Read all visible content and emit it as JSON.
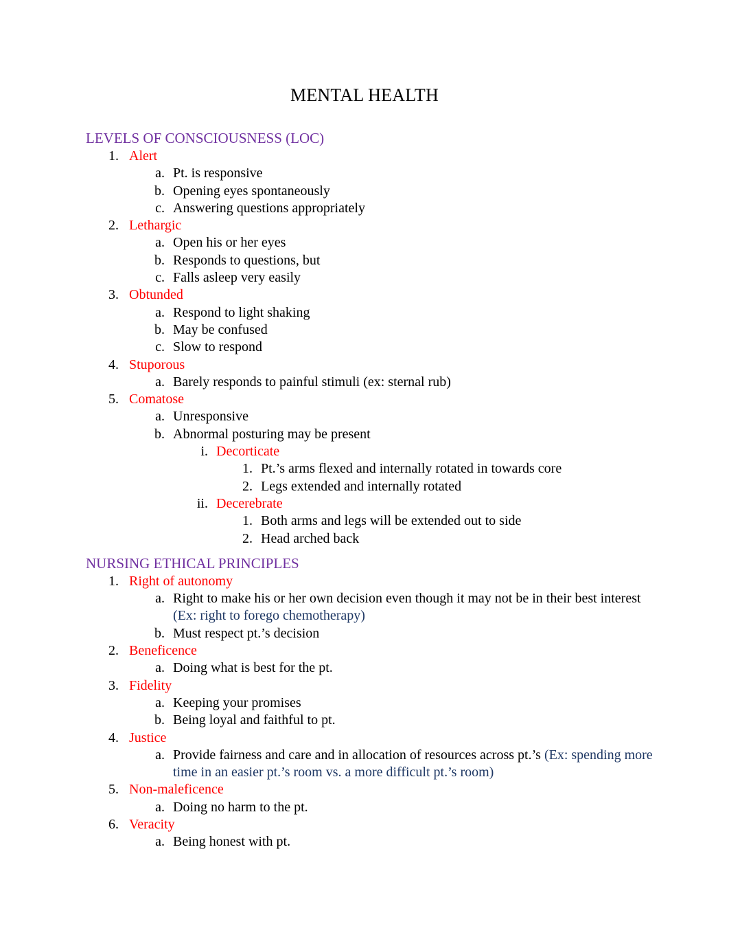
{
  "document": {
    "title": "MENTAL HEALTH"
  },
  "sections": [
    {
      "heading": "LEVELS OF CONSCIOUSNESS (LOC)",
      "items": [
        {
          "marker": "1.",
          "text": "Alert",
          "children": [
            {
              "marker": "a.",
              "text": "Pt. is responsive"
            },
            {
              "marker": "b.",
              "text": "Opening eyes spontaneously"
            },
            {
              "marker": "c.",
              "text": "Answering questions appropriately"
            }
          ]
        },
        {
          "marker": "2.",
          "text": "Lethargic",
          "children": [
            {
              "marker": "a.",
              "text": "Open his or her eyes"
            },
            {
              "marker": "b.",
              "text": "Responds to questions, but"
            },
            {
              "marker": "c.",
              "text": "Falls asleep very easily"
            }
          ]
        },
        {
          "marker": "3.",
          "text": "Obtunded",
          "children": [
            {
              "marker": "a.",
              "text": "Respond to light shaking"
            },
            {
              "marker": "b.",
              "text": "May be confused"
            },
            {
              "marker": "c.",
              "text": "Slow to respond"
            }
          ]
        },
        {
          "marker": "4.",
          "text": "Stuporous",
          "children": [
            {
              "marker": "a.",
              "text": "Barely responds to painful stimuli (ex: sternal rub)"
            }
          ]
        },
        {
          "marker": "5.",
          "text": "Comatose",
          "children": [
            {
              "marker": "a.",
              "text": "Unresponsive"
            },
            {
              "marker": "b.",
              "text": "Abnormal posturing may be present",
              "children": [
                {
                  "marker": "i.",
                  "text": "Decorticate",
                  "children": [
                    {
                      "marker": "1.",
                      "text": "Pt.’s arms flexed and internally rotated in towards core"
                    },
                    {
                      "marker": "2.",
                      "text": "Legs extended and internally rotated"
                    }
                  ]
                },
                {
                  "marker": "ii.",
                  "text": "Decerebrate",
                  "children": [
                    {
                      "marker": "1.",
                      "text": "Both arms and legs will be extended out to side"
                    },
                    {
                      "marker": "2.",
                      "text": "Head arched back"
                    }
                  ]
                }
              ]
            }
          ]
        }
      ]
    },
    {
      "heading": "NURSING ETHICAL PRINCIPLES",
      "items": [
        {
          "marker": "1.",
          "text": "Right of autonomy",
          "children": [
            {
              "marker": "a.",
              "text": "Right to make his or her own decision even though it may not be in their best interest ",
              "note": "(Ex: right to forego chemotherapy)"
            },
            {
              "marker": "b.",
              "text": "Must respect pt.’s decision"
            }
          ]
        },
        {
          "marker": "2.",
          "text": "Beneficence",
          "children": [
            {
              "marker": "a.",
              "text": "Doing what is best for the pt."
            }
          ]
        },
        {
          "marker": "3.",
          "text": "Fidelity",
          "children": [
            {
              "marker": "a.",
              "text": "Keeping your promises"
            },
            {
              "marker": "b.",
              "text": "Being loyal and faithful to pt."
            }
          ]
        },
        {
          "marker": "4.",
          "text": "Justice",
          "children": [
            {
              "marker": "a.",
              "text": "Provide fairness and care and in allocation of resources across pt.’s ",
              "note": "(Ex: spending more time in an easier pt.’s room vs. a more difficult pt.’s room)"
            }
          ]
        },
        {
          "marker": "5.",
          "text": "Non-maleficence",
          "children": [
            {
              "marker": "a.",
              "text": "Doing no harm to the pt."
            }
          ]
        },
        {
          "marker": "6.",
          "text": "Veracity",
          "children": [
            {
              "marker": "a.",
              "text": "Being honest with pt."
            }
          ]
        }
      ]
    }
  ],
  "colors": {
    "heading_purple": "#7030a0",
    "item_red": "#ff0000",
    "note_blue": "#1f3864",
    "body_black": "#000000"
  }
}
